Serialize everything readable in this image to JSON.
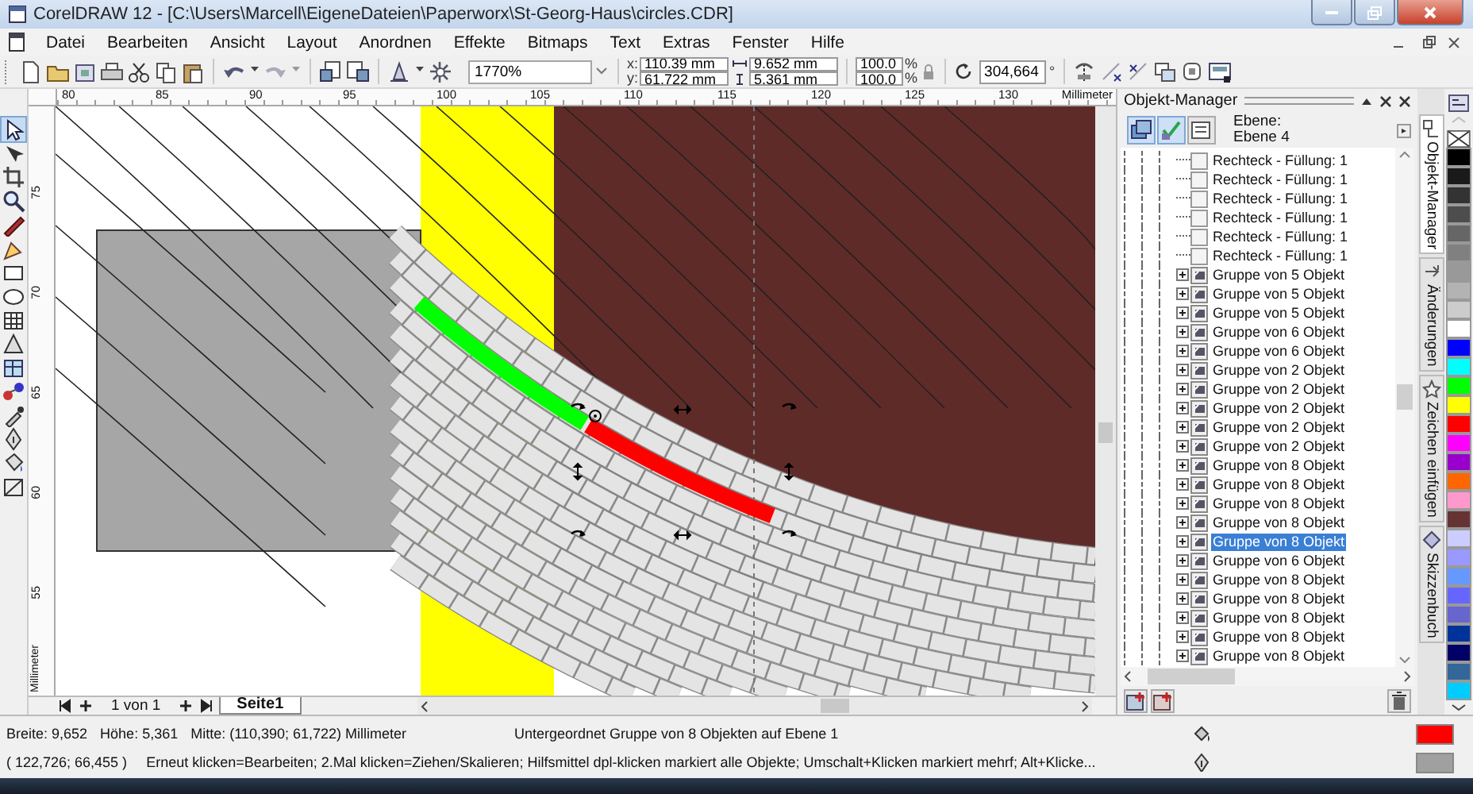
{
  "window": {
    "title": "CorelDRAW 12 - [C:\\Users\\Marcell\\EigeneDateien\\Paperworx\\St-Georg-Haus\\circles.CDR]"
  },
  "menu": [
    "Datei",
    "Bearbeiten",
    "Ansicht",
    "Layout",
    "Anordnen",
    "Effekte",
    "Bitmaps",
    "Text",
    "Extras",
    "Fenster",
    "Hilfe"
  ],
  "toolbar": {
    "zoom": "1770%",
    "position": [
      {
        "label": "x:",
        "value": "110.39 mm"
      },
      {
        "label": "y:",
        "value": "61.722 mm"
      }
    ],
    "size": [
      {
        "value": "9.652 mm"
      },
      {
        "value": "5.361 mm"
      }
    ],
    "scale": [
      {
        "value": "100.0",
        "unit": "%"
      },
      {
        "value": "100.0",
        "unit": "%"
      }
    ],
    "rotation": {
      "value": "304,664",
      "unit": "°"
    }
  },
  "rulers": {
    "horizontal": [
      "80",
      "85",
      "90",
      "95",
      "100",
      "105",
      "110",
      "115",
      "120",
      "125",
      "130"
    ],
    "horizontal_unit": "Millimeter",
    "vertical": [
      "75",
      "70",
      "65",
      "60",
      "55"
    ],
    "vertical_unit": "Millimeter"
  },
  "pages": {
    "counter": "1 von 1",
    "tabs": [
      {
        "label": "Seite1",
        "selected": true
      }
    ]
  },
  "object_manager": {
    "title": "Objekt-Manager",
    "layer_label": "Ebene:",
    "layer_name": "Ebene 4",
    "items": [
      {
        "kind": "rectangle",
        "label": "Rechteck - Füllung: 1",
        "selected": false
      },
      {
        "kind": "rectangle",
        "label": "Rechteck - Füllung: 1",
        "selected": false
      },
      {
        "kind": "rectangle",
        "label": "Rechteck - Füllung: 1",
        "selected": false
      },
      {
        "kind": "rectangle",
        "label": "Rechteck - Füllung: 1",
        "selected": false
      },
      {
        "kind": "rectangle",
        "label": "Rechteck - Füllung: 1",
        "selected": false
      },
      {
        "kind": "rectangle",
        "label": "Rechteck - Füllung: 1",
        "selected": false
      },
      {
        "kind": "group",
        "label": "Gruppe von 5 Objekt",
        "selected": false
      },
      {
        "kind": "group",
        "label": "Gruppe von 5 Objekt",
        "selected": false
      },
      {
        "kind": "group",
        "label": "Gruppe von 5 Objekt",
        "selected": false
      },
      {
        "kind": "group",
        "label": "Gruppe von 6 Objekt",
        "selected": false
      },
      {
        "kind": "group",
        "label": "Gruppe von 6 Objekt",
        "selected": false
      },
      {
        "kind": "group",
        "label": "Gruppe von 2 Objekt",
        "selected": false
      },
      {
        "kind": "group",
        "label": "Gruppe von 2 Objekt",
        "selected": false
      },
      {
        "kind": "group",
        "label": "Gruppe von 2 Objekt",
        "selected": false
      },
      {
        "kind": "group",
        "label": "Gruppe von 2 Objekt",
        "selected": false
      },
      {
        "kind": "group",
        "label": "Gruppe von 2 Objekt",
        "selected": false
      },
      {
        "kind": "group",
        "label": "Gruppe von 8 Objekt",
        "selected": false
      },
      {
        "kind": "group",
        "label": "Gruppe von 8 Objekt",
        "selected": false
      },
      {
        "kind": "group",
        "label": "Gruppe von 8 Objekt",
        "selected": false
      },
      {
        "kind": "group",
        "label": "Gruppe von 8 Objekt",
        "selected": false
      },
      {
        "kind": "group",
        "label": "Gruppe von 8 Objekt",
        "selected": true
      },
      {
        "kind": "group",
        "label": "Gruppe von 6 Objekt",
        "selected": false
      },
      {
        "kind": "group",
        "label": "Gruppe von 8 Objekt",
        "selected": false
      },
      {
        "kind": "group",
        "label": "Gruppe von 8 Objekt",
        "selected": false
      },
      {
        "kind": "group",
        "label": "Gruppe von 8 Objekt",
        "selected": false
      },
      {
        "kind": "group",
        "label": "Gruppe von 8 Objekt",
        "selected": false
      },
      {
        "kind": "group",
        "label": "Gruppe von 8 Objekt",
        "selected": false
      }
    ]
  },
  "docker_tabs": [
    {
      "label": "Objekt-Manager",
      "selected": true
    },
    {
      "label": "Änderungen",
      "selected": false
    },
    {
      "label": "Zeichen einfügen",
      "selected": false
    },
    {
      "label": "Skizzenbuch",
      "selected": false
    }
  ],
  "palette": [
    {
      "kind": "none"
    },
    {
      "kind": "color",
      "color": "#000000"
    },
    {
      "kind": "color",
      "color": "#1a1a1a"
    },
    {
      "kind": "color",
      "color": "#333333"
    },
    {
      "kind": "color",
      "color": "#4d4d4d"
    },
    {
      "kind": "color",
      "color": "#666666"
    },
    {
      "kind": "color",
      "color": "#808080"
    },
    {
      "kind": "color",
      "color": "#999999"
    },
    {
      "kind": "color",
      "color": "#b3b3b3"
    },
    {
      "kind": "color",
      "color": "#cccccc"
    },
    {
      "kind": "color",
      "color": "#ffffff"
    },
    {
      "kind": "color",
      "color": "#0000ff"
    },
    {
      "kind": "color",
      "color": "#00ffff"
    },
    {
      "kind": "color",
      "color": "#00ff00"
    },
    {
      "kind": "color",
      "color": "#ffff00"
    },
    {
      "kind": "color",
      "color": "#ff0000"
    },
    {
      "kind": "color",
      "color": "#ff00ff"
    },
    {
      "kind": "color",
      "color": "#9900cc"
    },
    {
      "kind": "color",
      "color": "#ff6600"
    },
    {
      "kind": "color",
      "color": "#ff99cc"
    },
    {
      "kind": "color",
      "color": "#663333"
    },
    {
      "kind": "color",
      "color": "#ccccff"
    },
    {
      "kind": "color",
      "color": "#9999ff"
    },
    {
      "kind": "color",
      "color": "#6699ff"
    },
    {
      "kind": "color",
      "color": "#6666ff"
    },
    {
      "kind": "color",
      "color": "#6666cc"
    },
    {
      "kind": "color",
      "color": "#003399"
    },
    {
      "kind": "color",
      "color": "#000066"
    },
    {
      "kind": "color",
      "color": "#336699"
    },
    {
      "kind": "color",
      "color": "#00ccff"
    }
  ],
  "status_bar": {
    "width": "Breite: 9,652",
    "height": "Höhe: 5,361",
    "center": "Mitte: (110,390; 61,722) Millimeter",
    "selection": "Untergeordnet Gruppe von 8 Objekten auf Ebene 1",
    "cursor": "( 122,726; 66,455 )",
    "hint": "Erneut klicken=Bearbeiten; 2.Mal klicken=Ziehen/Skalieren; Hilfsmittel dpl-klicken markiert alle Objekte; Umschalt+Klicken markiert mehrf; Alt+Klicke...",
    "swatches": [
      {
        "kind": "fill",
        "color": "#ff0000"
      },
      {
        "kind": "outline",
        "color": "#a0a0a0"
      }
    ]
  }
}
